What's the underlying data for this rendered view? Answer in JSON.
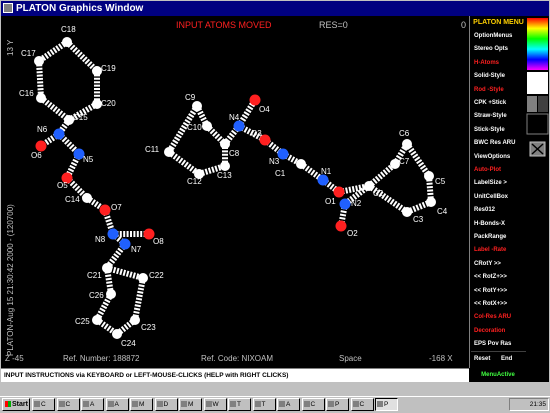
{
  "window": {
    "title": "PLATON Graphics Window"
  },
  "canvas": {
    "header_title": "INPUT ATOMS MOVED",
    "res_label": "RES=0",
    "top_right_value": "0",
    "left_vertical_text": "PLATON-Aug 15 21:30:42 2000 - (120700)",
    "left_top_vertical": "13 Y",
    "bottom_line": {
      "z": "Z -45",
      "ref_number": "Ref. Number: 188872",
      "ref_code": "Ref. Code: NIXOAM",
      "space": "Space",
      "x": "-168 X"
    },
    "atom_labels": [
      {
        "id": "C18",
        "text": "C18"
      },
      {
        "id": "C17",
        "text": "C17"
      },
      {
        "id": "C19",
        "text": "C19"
      },
      {
        "id": "C16",
        "text": "C16"
      },
      {
        "id": "C20",
        "text": "C20"
      },
      {
        "id": "C15",
        "text": "C15"
      },
      {
        "id": "N6",
        "text": "N6"
      },
      {
        "id": "O6",
        "text": "O6"
      },
      {
        "id": "N5",
        "text": "N5"
      },
      {
        "id": "O5",
        "text": "O5"
      },
      {
        "id": "C14",
        "text": "C14"
      },
      {
        "id": "O7",
        "text": "O7"
      },
      {
        "id": "N8",
        "text": "N8"
      },
      {
        "id": "O8",
        "text": "O8"
      },
      {
        "id": "N7",
        "text": "N7"
      },
      {
        "id": "C21",
        "text": "C21"
      },
      {
        "id": "C22",
        "text": "C22"
      },
      {
        "id": "C26",
        "text": "C26"
      },
      {
        "id": "C25",
        "text": "C25"
      },
      {
        "id": "C23",
        "text": "C23"
      },
      {
        "id": "C24",
        "text": "C24"
      },
      {
        "id": "C9",
        "text": "C9"
      },
      {
        "id": "C10",
        "text": "C10"
      },
      {
        "id": "N4",
        "text": "N4"
      },
      {
        "id": "O4",
        "text": "O4"
      },
      {
        "id": "O3",
        "text": "O3"
      },
      {
        "id": "C8",
        "text": "C8"
      },
      {
        "id": "C11",
        "text": "C11"
      },
      {
        "id": "C12",
        "text": "C12"
      },
      {
        "id": "C13",
        "text": "C13"
      },
      {
        "id": "N3",
        "text": "N3"
      },
      {
        "id": "C1",
        "text": "C1"
      },
      {
        "id": "N1",
        "text": "N1"
      },
      {
        "id": "O1",
        "text": "O1"
      },
      {
        "id": "C6",
        "text": "C6"
      },
      {
        "id": "C7",
        "text": "C7"
      },
      {
        "id": "C5",
        "text": "C5"
      },
      {
        "id": "C2",
        "text": "C2"
      },
      {
        "id": "N2",
        "text": "N2"
      },
      {
        "id": "C3",
        "text": "C3"
      },
      {
        "id": "C4",
        "text": "C4"
      },
      {
        "id": "O2",
        "text": "O2"
      }
    ]
  },
  "menu": {
    "header": "PLATON MENU",
    "items": [
      {
        "label": "OptionMenus",
        "color": "white"
      },
      {
        "label": "Stereo Opts",
        "color": "white"
      },
      {
        "label": "H-Atoms",
        "color": "red"
      },
      {
        "label": "Solid-Style",
        "color": "white"
      },
      {
        "label": "Rod -Style",
        "color": "red"
      },
      {
        "label": "CPK +Stick",
        "color": "white"
      },
      {
        "label": "Straw-Style",
        "color": "white"
      },
      {
        "label": "Stick-Style",
        "color": "white"
      },
      {
        "label": "BWC Res ARU",
        "color": "white"
      },
      {
        "label": "ViewOptions",
        "color": "white"
      },
      {
        "label": "Auto-Plot",
        "color": "red"
      },
      {
        "label": "LabelSize >",
        "color": "white"
      },
      {
        "label": "UnitCellBox",
        "color": "white"
      },
      {
        "label": "Res012",
        "color": "white"
      },
      {
        "label": "H-Bonds-X",
        "color": "white"
      },
      {
        "label": "PackRange",
        "color": "white"
      },
      {
        "label": "Label -Rate",
        "color": "red"
      },
      {
        "label": "CRotY >>",
        "color": "white"
      },
      {
        "label": "<< RotZ+>>",
        "color": "white"
      },
      {
        "label": "<< RotY+>>",
        "color": "white"
      },
      {
        "label": "<< RotX+>>",
        "color": "white"
      },
      {
        "label": "Col-Res ARU",
        "color": "red"
      },
      {
        "label": "Decoration",
        "color": "red"
      },
      {
        "label": "EPS Pov Ras",
        "color": "white"
      }
    ],
    "reset": "Reset",
    "end": "End",
    "exit": "EXIT",
    "menu_active": "MenuActive"
  },
  "status": {
    "instructions": "INPUT INSTRUCTIONS via KEYBOARD or LEFT-MOUSE-CLICKS (HELP with RIGHT CLICKS)"
  },
  "taskbar": {
    "start": "Start",
    "buttons": [
      {
        "label": "C"
      },
      {
        "label": "C"
      },
      {
        "label": "A"
      },
      {
        "label": "A"
      },
      {
        "label": "M"
      },
      {
        "label": "D"
      },
      {
        "label": "M"
      },
      {
        "label": "W"
      },
      {
        "label": "T"
      },
      {
        "label": "T"
      },
      {
        "label": "A"
      },
      {
        "label": "C"
      },
      {
        "label": "P"
      },
      {
        "label": "C"
      },
      {
        "label": "P"
      }
    ],
    "tray_time": "21:35",
    "right_text": "None"
  },
  "colors": {
    "carbon": "#ffffff",
    "nitrogen": "#2060ff",
    "oxygen": "#ff2020",
    "label": "#ffffff",
    "header_red": "#ff2020"
  }
}
